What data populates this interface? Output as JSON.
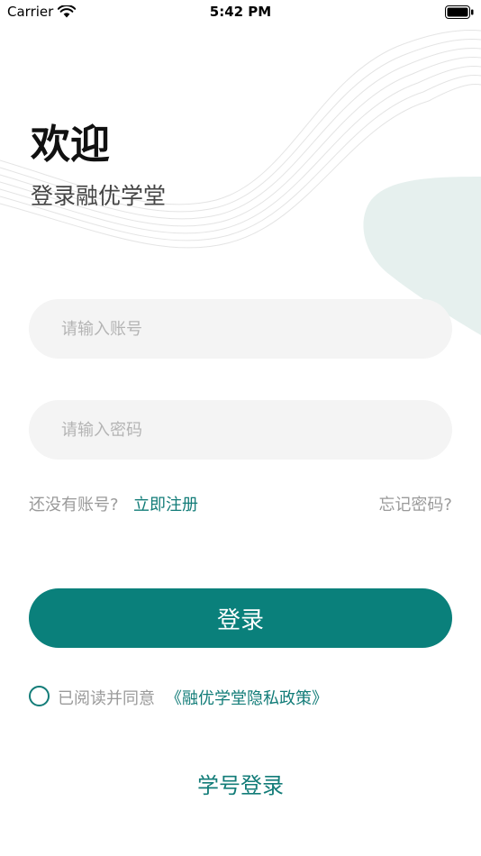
{
  "status_bar": {
    "carrier": "Carrier",
    "time": "5:42 PM"
  },
  "header": {
    "title": "欢迎",
    "subtitle": "登录融优学堂"
  },
  "form": {
    "account_placeholder": "请输入账号",
    "password_placeholder": "请输入密码",
    "account_value": "",
    "password_value": ""
  },
  "links": {
    "no_account": "还没有账号?",
    "register": "立即注册",
    "forgot_password": "忘记密码?"
  },
  "login_button": {
    "label": "登录"
  },
  "agreement": {
    "checked": false,
    "text": "已阅读并同意",
    "policy": "《融优学堂隐私政策》"
  },
  "alt_login": {
    "label": "学号登录"
  },
  "colors": {
    "accent": "#0a807b",
    "link": "#127c78",
    "input_bg": "#f4f4f4",
    "placeholder": "#b4b4b4",
    "muted_text": "#9a9a9a",
    "decoration": "#e6f0ee"
  },
  "icons": {
    "wifi": "wifi-icon",
    "battery": "battery-icon",
    "checkbox": "circle-checkbox-icon"
  }
}
